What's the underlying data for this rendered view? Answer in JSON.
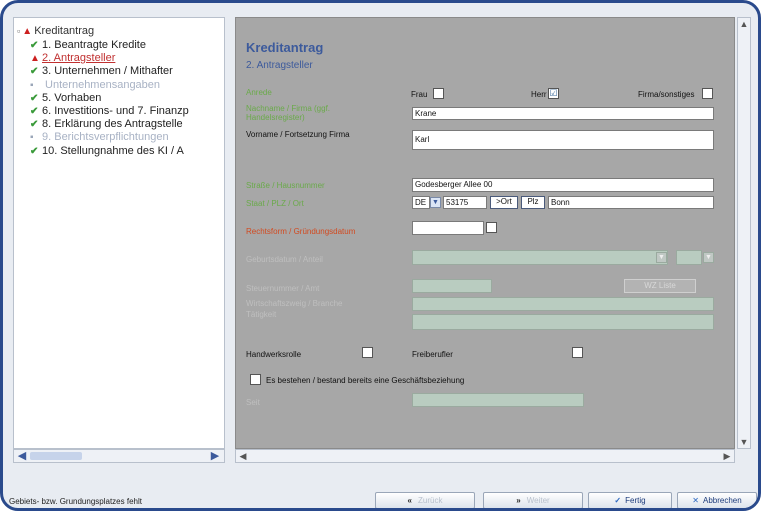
{
  "tree": {
    "root_label": "Kreditantrag",
    "items": [
      {
        "icon": "check",
        "label": "1. Beantragte Kredite",
        "state": "normal"
      },
      {
        "icon": "warn",
        "label": "2. Antragsteller",
        "state": "active"
      },
      {
        "icon": "check",
        "label": "3. Unternehmen / Mithafter",
        "state": "normal"
      },
      {
        "icon": "dot",
        "label": "    Unternehmensangaben",
        "state": "dim"
      },
      {
        "icon": "check",
        "label": "5. Vorhaben",
        "state": "normal"
      },
      {
        "icon": "check",
        "label": "6. Investitions- und 7. Finanzp",
        "state": "normal"
      },
      {
        "icon": "check",
        "label": "8. Erklärung des Antragstelle",
        "state": "normal"
      },
      {
        "icon": "dot",
        "label": "9. Berichtsverpflichtungen",
        "state": "dim"
      },
      {
        "icon": "check",
        "label": "10. Stellungnahme des KI / A",
        "state": "normal"
      }
    ]
  },
  "form": {
    "title": "Kreditantrag",
    "subtitle": "2. Antragsteller",
    "anrede_label": "Anrede",
    "frau_label": "Frau",
    "herr_label": "Herr",
    "firma_label": "Firma/sonstiges",
    "herr_checked": "☑",
    "nachname_label": "Nachname / Firma (ggf. Handelsregister)",
    "nachname_value": "Krane",
    "vorname_label": "Vorname / Fortsetzung Firma",
    "vorname_value": "Karl",
    "strasse_label": "Straße / Hausnummer",
    "strasse_value": "Godesberger Allee 00",
    "staat_label": "Staat / PLZ / Ort",
    "staat_value": "DE",
    "plz_value": "53175",
    "ort_btn": ">Ort",
    "plz_btn": "Plz",
    "ort_value": "Bonn",
    "rechtsform_label": "Rechtsform / Gründungsdatum",
    "faded_label_1": "Geburtsdatum / Anteil",
    "faded_label_2": "Steuernummer / Amt",
    "faded_label_3": "Wirtschaftszweig / Branche",
    "faded_label_4": "Tätigkeit",
    "wz_button": "WZ Liste",
    "mark_label": "Handwerksrolle",
    "freiberufler_label": "Freiberufler",
    "geschaeft_label": "Es bestehen / bestand bereits eine Geschäftsbeziehung",
    "seit_label": "Seit"
  },
  "statusbar": {
    "text": "Gebiets- bzw. Grundungsplatzes fehlt",
    "prev_label": "Zurück",
    "next_label": "Weiter",
    "finish_label": "Fertig",
    "cancel_label": "Abbrechen"
  }
}
